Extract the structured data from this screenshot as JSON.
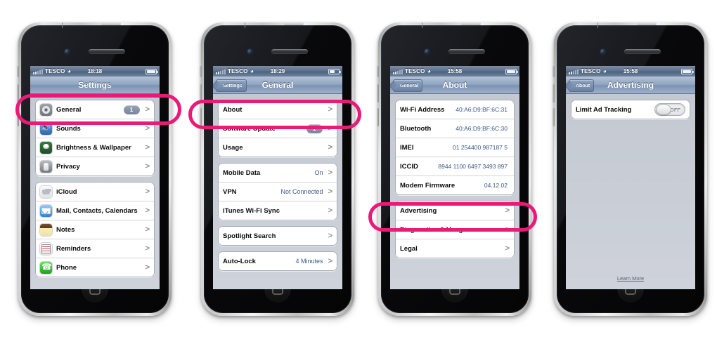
{
  "phones": [
    {
      "id": "phone-settings",
      "status": {
        "carrier": "TESCO",
        "time": "18:18",
        "wifi_icon": "wifi-icon",
        "signal_icon": "signal-bars-icon",
        "battery_icon": "battery-icon"
      },
      "nav": {
        "title": "Settings",
        "back": null
      },
      "groups": [
        {
          "rows": [
            {
              "label": "General",
              "icon": "general-gear-icon",
              "badge": "1",
              "chevron": ">"
            },
            {
              "label": "Sounds",
              "icon": "sounds-speaker-icon",
              "chevron": ">"
            },
            {
              "label": "Brightness & Wallpaper",
              "icon": "brightness-wallpaper-icon",
              "chevron": ">"
            },
            {
              "label": "Privacy",
              "icon": "privacy-hand-icon",
              "chevron": ">"
            }
          ]
        },
        {
          "rows": [
            {
              "label": "iCloud",
              "icon": "icloud-icon",
              "chevron": ">"
            },
            {
              "label": "Mail, Contacts, Calendars",
              "icon": "mail-icon",
              "chevron": ">"
            },
            {
              "label": "Notes",
              "icon": "notes-icon",
              "chevron": ">"
            },
            {
              "label": "Reminders",
              "icon": "reminders-icon",
              "chevron": ">"
            },
            {
              "label": "Phone",
              "icon": "phone-icon",
              "chevron": ">"
            }
          ]
        }
      ]
    },
    {
      "id": "phone-general",
      "status": {
        "carrier": "TESCO",
        "time": "18:29",
        "wifi_icon": "wifi-icon",
        "signal_icon": "signal-bars-icon",
        "battery_icon": "battery-icon"
      },
      "nav": {
        "title": "General",
        "back": "Settings"
      },
      "groups": [
        {
          "rows": [
            {
              "label": "About",
              "chevron": ">"
            },
            {
              "label": "Software Update",
              "badge": "1",
              "chevron": ">"
            },
            {
              "label": "Usage",
              "chevron": ">"
            }
          ]
        },
        {
          "rows": [
            {
              "label": "Mobile Data",
              "value": "On",
              "chevron": ">"
            },
            {
              "label": "VPN",
              "value": "Not Connected",
              "chevron": ">"
            },
            {
              "label": "iTunes Wi-Fi Sync",
              "chevron": ">"
            }
          ]
        },
        {
          "rows": [
            {
              "label": "Spotlight Search",
              "chevron": ">"
            }
          ]
        },
        {
          "rows": [
            {
              "label": "Auto-Lock",
              "value": "4 Minutes",
              "chevron": ">"
            }
          ]
        }
      ]
    },
    {
      "id": "phone-about",
      "status": {
        "carrier": "TESCO",
        "time": "15:58",
        "wifi_icon": "wifi-icon",
        "signal_icon": "signal-bars-icon",
        "battery_icon": "battery-icon"
      },
      "nav": {
        "title": "About",
        "back": "General"
      },
      "groups": [
        {
          "rows": [
            {
              "label": "Wi-Fi Address",
              "value": "40:A6:D9:BF:6C:31"
            },
            {
              "label": "Bluetooth",
              "value": "40:A6:D9:BF:6C:30"
            },
            {
              "label": "IMEI",
              "value": "01 254400 987187 5"
            },
            {
              "label": "ICCID",
              "value": "8944 1100 6497 3493 897"
            },
            {
              "label": "Modem Firmware",
              "value": "04.12.02"
            }
          ]
        },
        {
          "rows": [
            {
              "label": "Advertising",
              "chevron": ">"
            },
            {
              "label": "Diagnostics & Usage",
              "chevron": ">"
            },
            {
              "label": "Legal",
              "chevron": ">"
            }
          ]
        }
      ]
    },
    {
      "id": "phone-advertising",
      "status": {
        "carrier": "TESCO",
        "time": "15:58",
        "wifi_icon": "wifi-icon",
        "signal_icon": "signal-bars-icon",
        "battery_icon": "battery-icon"
      },
      "nav": {
        "title": "Advertising",
        "back": "About"
      },
      "groups": [
        {
          "rows": [
            {
              "label": "Limit Ad Tracking",
              "toggle": "OFF"
            }
          ]
        }
      ],
      "footer_link": "Learn More"
    }
  ],
  "highlights": {
    "color": "#ea1a79",
    "regions": [
      {
        "target": "General",
        "phone": 1
      },
      {
        "target": "About",
        "phone": 2
      },
      {
        "target": "Advertising",
        "phone": 3
      }
    ]
  }
}
